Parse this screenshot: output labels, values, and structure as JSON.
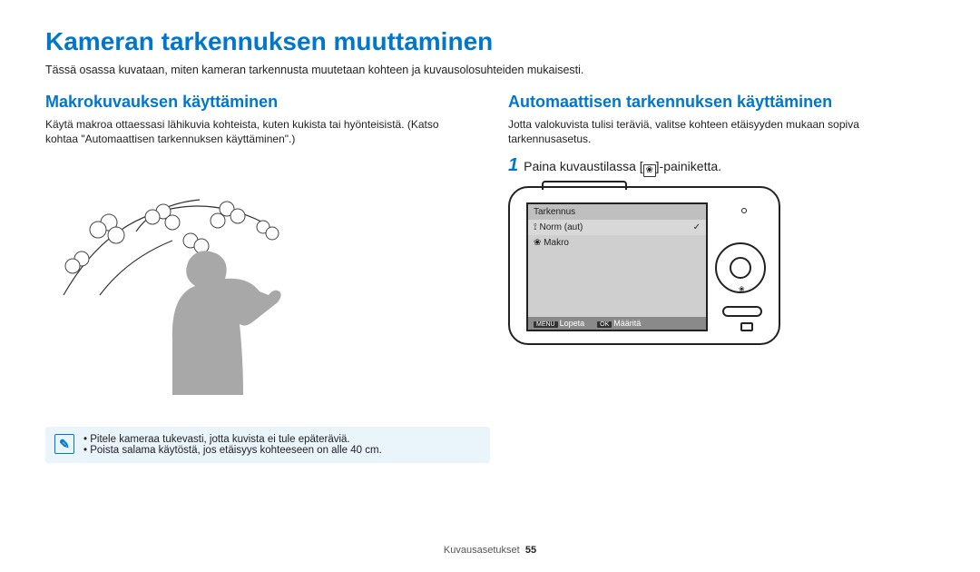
{
  "page": {
    "title": "Kameran tarkennuksen muuttaminen",
    "intro": "Tässä osassa kuvataan, miten kameran tarkennusta muutetaan kohteen ja kuvausolosuhteiden mukaisesti."
  },
  "left": {
    "heading": "Makrokuvauksen käyttäminen",
    "body": "Käytä makroa ottaessasi lähikuvia kohteista, kuten kukista tai hyönteisistä. (Katso kohtaa \"Automaattisen tarkennuksen käyttäminen\".)"
  },
  "right": {
    "heading": "Automaattisen tarkennuksen käyttäminen",
    "body": "Jotta valokuvista tulisi teräviä, valitse kohteen etäisyyden mukaan sopiva tarkennusasetus.",
    "step_num": "1",
    "step_text_pre": "Paina kuvaustilassa [",
    "step_text_post": "]-painiketta.",
    "screen": {
      "header": "Tarkennus",
      "row1_icon": "⟟",
      "row1_label": "Norm (aut)",
      "row1_check": "✓",
      "row2_icon": "❀",
      "row2_label": "Makro",
      "footer_menu_tag": "MENU",
      "footer_menu": "Lopeta",
      "footer_ok_tag": "OK",
      "footer_ok": "Määritä"
    },
    "dpad_bottom_icon": "❀"
  },
  "note": {
    "items": [
      "Pitele kameraa tukevasti, jotta kuvista ei tule epäteräviä.",
      "Poista salama käytöstä, jos etäisyys kohteeseen on alle 40 cm."
    ]
  },
  "footer": {
    "section": "Kuvausasetukset",
    "page_num": "55"
  }
}
